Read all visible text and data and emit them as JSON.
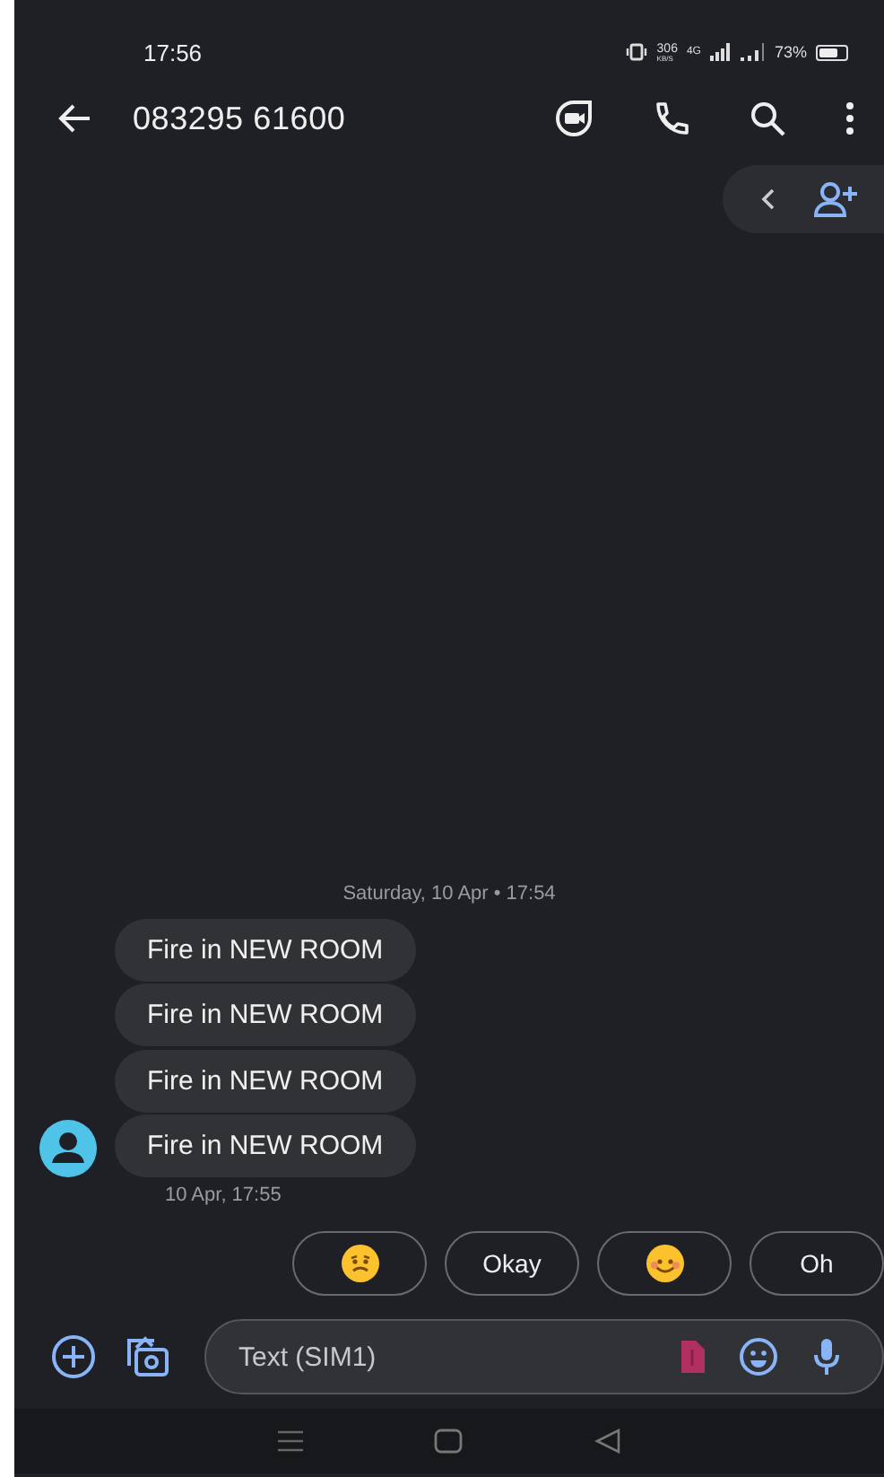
{
  "status_bar": {
    "time": "17:56",
    "speed_value": "306",
    "speed_unit": "KB/S",
    "network": "4G",
    "battery": "73%"
  },
  "header": {
    "title": "083295 61600"
  },
  "date_divider": "Saturday, 10 Apr • 17:54",
  "messages": [
    {
      "text": "Fire in NEW ROOM"
    },
    {
      "text": "Fire in NEW ROOM"
    },
    {
      "text": "Fire in NEW ROOM"
    },
    {
      "text": "Fire in NEW ROOM",
      "avatar": true
    }
  ],
  "timestamp": "10 Apr, 17:55",
  "suggestions": [
    {
      "kind": "worried"
    },
    {
      "kind": "text",
      "label": "Okay"
    },
    {
      "kind": "smile"
    },
    {
      "kind": "text",
      "label": "Oh"
    }
  ],
  "composer": {
    "placeholder": "Text (SIM1)"
  }
}
